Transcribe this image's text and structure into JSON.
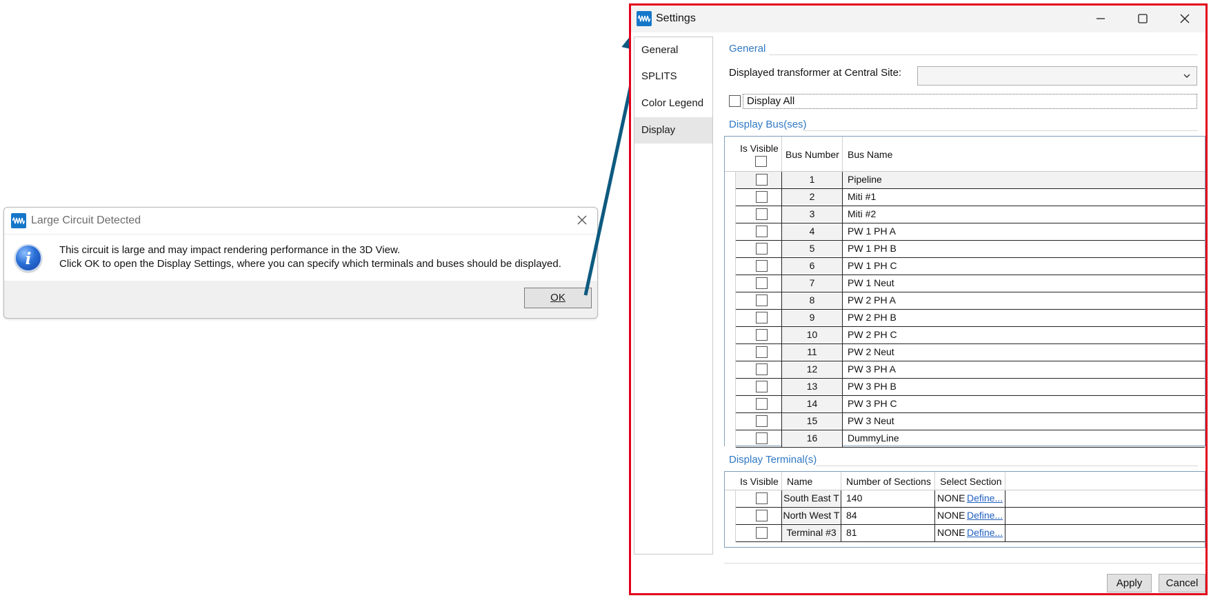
{
  "alert_dialog": {
    "title": "Large Circuit Detected",
    "message_line1": "This circuit is large and may impact rendering performance in the 3D View.",
    "message_line2": "Click OK to open the Display Settings, where you can specify which terminals and buses should be displayed.",
    "ok_label": "OK"
  },
  "settings": {
    "title": "Settings",
    "nav": [
      "General",
      "SPLITS",
      "Color Legend",
      "Display"
    ],
    "nav_selected": "Display",
    "general_section": "General",
    "transformer_label": "Displayed transformer at Central Site:",
    "transformer_value": "",
    "display_all_label": "Display All",
    "display_all_checked": false,
    "buses_section": "Display Bus(ses)",
    "bus_columns": [
      "Is Visible",
      "Bus Number",
      "Bus Name"
    ],
    "buses": [
      {
        "number": "1",
        "name": "Pipeline",
        "visible": false
      },
      {
        "number": "2",
        "name": "Miti #1",
        "visible": false
      },
      {
        "number": "3",
        "name": "Miti #2",
        "visible": false
      },
      {
        "number": "4",
        "name": "PW 1 PH A",
        "visible": false
      },
      {
        "number": "5",
        "name": "PW 1 PH B",
        "visible": false
      },
      {
        "number": "6",
        "name": "PW 1 PH C",
        "visible": false
      },
      {
        "number": "7",
        "name": "PW 1 Neut",
        "visible": false
      },
      {
        "number": "8",
        "name": "PW 2 PH A",
        "visible": false
      },
      {
        "number": "9",
        "name": "PW 2 PH B",
        "visible": false
      },
      {
        "number": "10",
        "name": "PW 2 PH C",
        "visible": false
      },
      {
        "number": "11",
        "name": "PW 2 Neut",
        "visible": false
      },
      {
        "number": "12",
        "name": "PW 3 PH A",
        "visible": false
      },
      {
        "number": "13",
        "name": "PW 3 PH B",
        "visible": false
      },
      {
        "number": "14",
        "name": "PW 3 PH C",
        "visible": false
      },
      {
        "number": "15",
        "name": "PW 3 Neut",
        "visible": false
      },
      {
        "number": "16",
        "name": "DummyLine",
        "visible": false
      }
    ],
    "terminals_section": "Display Terminal(s)",
    "terminal_columns": [
      "Is Visible",
      "Name",
      "Number of Sections",
      "Select Section"
    ],
    "terminals": [
      {
        "name": "South East T",
        "sections": "140",
        "section_value": "NONE",
        "define_label": "Define...",
        "visible": false
      },
      {
        "name": "North West T",
        "sections": "84",
        "section_value": "NONE",
        "define_label": "Define...",
        "visible": false
      },
      {
        "name": "Terminal #3",
        "sections": "81",
        "section_value": "NONE",
        "define_label": "Define...",
        "visible": false
      }
    ],
    "apply_label": "Apply",
    "cancel_label": "Cancel"
  },
  "colors": {
    "highlight_border": "#e2001a",
    "arrow": "#0e5a80",
    "section_title": "#2f78c4",
    "app_icon": "#1677c9"
  },
  "icons": {
    "app": "waveform-app-icon",
    "info": "information-icon",
    "close": "close-icon",
    "minimize": "minimize-icon",
    "maximize": "maximize-icon",
    "dropdown": "chevron-down-icon"
  }
}
